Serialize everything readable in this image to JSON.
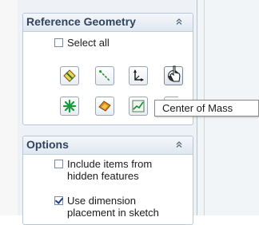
{
  "reference_geometry": {
    "title": "Reference Geometry",
    "select_all_label": "Select all",
    "select_all_checked": false,
    "tools": [
      {
        "name": "plane",
        "icon": "plane-icon"
      },
      {
        "name": "axis",
        "icon": "axis-icon"
      },
      {
        "name": "coordinate system",
        "icon": "coordinate-system-icon"
      },
      {
        "name": "center of mass",
        "icon": "center-of-mass-icon"
      },
      {
        "name": "point",
        "icon": "point-icon"
      },
      {
        "name": "mate reference",
        "icon": "mate-reference-icon"
      },
      {
        "name": "curve",
        "icon": "curve-icon"
      },
      {
        "name": "bounding box",
        "icon": "bounding-box-icon"
      }
    ]
  },
  "tooltip": {
    "text": "Center of Mass"
  },
  "options": {
    "title": "Options",
    "include_hidden_line1": "Include items from",
    "include_hidden_line2": "hidden features",
    "include_hidden_checked": false,
    "use_dimension_line1": "Use dimension",
    "use_dimension_line2": "placement in sketch",
    "use_dimension_checked": true
  },
  "colors": {
    "panel_bg": "#eef2f6",
    "header_text": "#33445a",
    "accent_green": "#1a9a3a",
    "accent_orange": "#e08a1e"
  }
}
